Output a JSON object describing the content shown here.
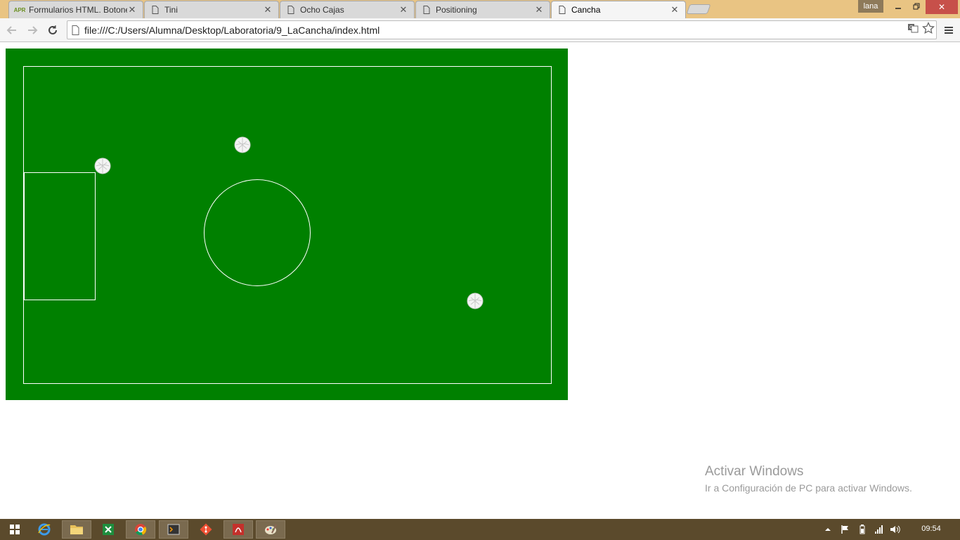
{
  "tabs": [
    {
      "title": "Formularios HTML. Botone",
      "icon": "apr-favicon"
    },
    {
      "title": "Tini",
      "icon": "page-icon"
    },
    {
      "title": "Ocho Cajas",
      "icon": "page-icon"
    },
    {
      "title": "Positioning",
      "icon": "page-icon"
    },
    {
      "title": "Cancha",
      "icon": "page-icon",
      "active": true
    }
  ],
  "favicon_text": "APR",
  "window": {
    "profile_name": "lana"
  },
  "toolbar": {
    "url": "file:///C:/Users/Alumna/Desktop/Laboratoria/9_LaCancha/index.html"
  },
  "page": {
    "field_color": "#008000",
    "line_color": "#ffffff",
    "balls": 3
  },
  "watermark": {
    "title": "Activar Windows",
    "subtitle": "Ir a Configuración de PC para activar Windows."
  },
  "taskbar": {
    "apps": [
      "start-icon",
      "internet-explorer-icon",
      "file-explorer-icon",
      "excel-icon",
      "chrome-icon",
      "terminal-icon",
      "git-icon",
      "acrobat-icon",
      "paint-icon"
    ],
    "clock": "09:54",
    "colors": {
      "bar": "#5b4a2c"
    }
  }
}
